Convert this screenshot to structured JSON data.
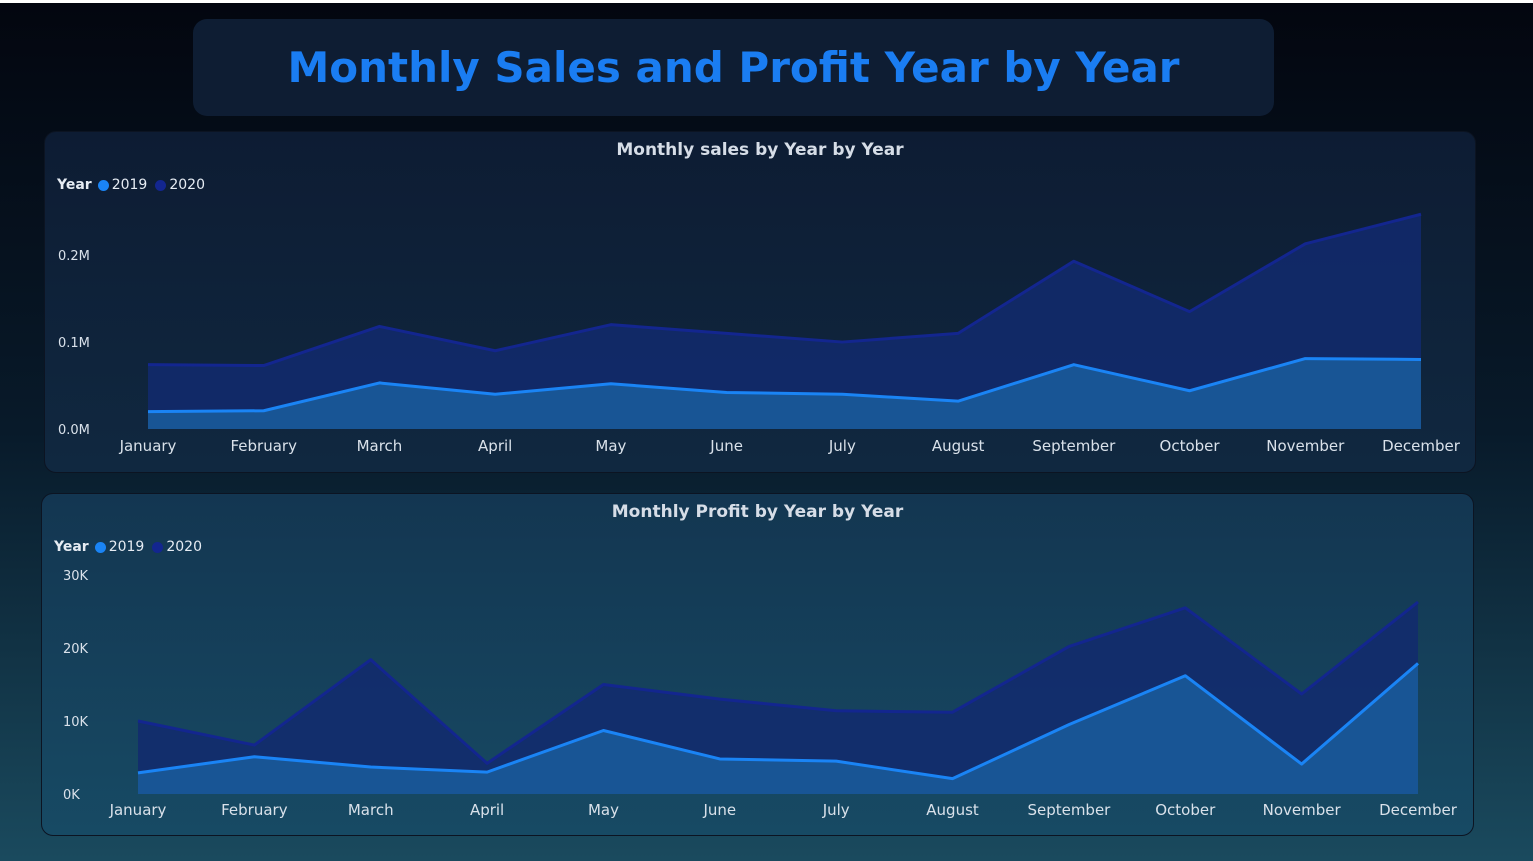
{
  "page": {
    "title": "Monthly Sales and Profit Year by Year"
  },
  "colors": {
    "series_2019": "#1a84f5",
    "series_2020": "#13268f",
    "title": "#1a7df2"
  },
  "chart_data": [
    {
      "type": "area",
      "title": "Monthly sales by Year by Year",
      "legend_title": "Year",
      "legend_position": "top-left",
      "categories": [
        "January",
        "February",
        "March",
        "April",
        "May",
        "June",
        "July",
        "August",
        "September",
        "October",
        "November",
        "December"
      ],
      "y_ticks": [
        {
          "value": 0,
          "label": "0.0M"
        },
        {
          "value": 100000,
          "label": "0.1M"
        },
        {
          "value": 200000,
          "label": "0.2M"
        }
      ],
      "ylim": [
        0,
        245000
      ],
      "grid": false,
      "series": [
        {
          "name": "2019",
          "values": [
            20000,
            21000,
            53000,
            40000,
            52000,
            42000,
            40000,
            32000,
            74000,
            44000,
            81000,
            80000
          ]
        },
        {
          "name": "2020",
          "values": [
            74000,
            73000,
            118000,
            90000,
            120000,
            110000,
            100000,
            110000,
            193000,
            135000,
            213000,
            247000
          ]
        }
      ]
    },
    {
      "type": "area",
      "title": "Monthly Profit by Year by Year",
      "legend_title": "Year",
      "legend_position": "top-left",
      "categories": [
        "January",
        "February",
        "March",
        "April",
        "May",
        "June",
        "July",
        "August",
        "September",
        "October",
        "November",
        "December"
      ],
      "y_ticks": [
        {
          "value": 0,
          "label": "0K"
        },
        {
          "value": 10000,
          "label": "10K"
        },
        {
          "value": 20000,
          "label": "20K"
        },
        {
          "value": 30000,
          "label": "30K"
        }
      ],
      "ylim": [
        0,
        30000
      ],
      "grid": false,
      "series": [
        {
          "name": "2019",
          "values": [
            2900,
            5100,
            3700,
            3000,
            8700,
            4800,
            4500,
            2100,
            9500,
            16200,
            4100,
            17900
          ]
        },
        {
          "name": "2020",
          "values": [
            10000,
            6700,
            18400,
            4200,
            15000,
            13000,
            11400,
            11200,
            20200,
            25500,
            13700,
            26300
          ]
        }
      ]
    }
  ]
}
